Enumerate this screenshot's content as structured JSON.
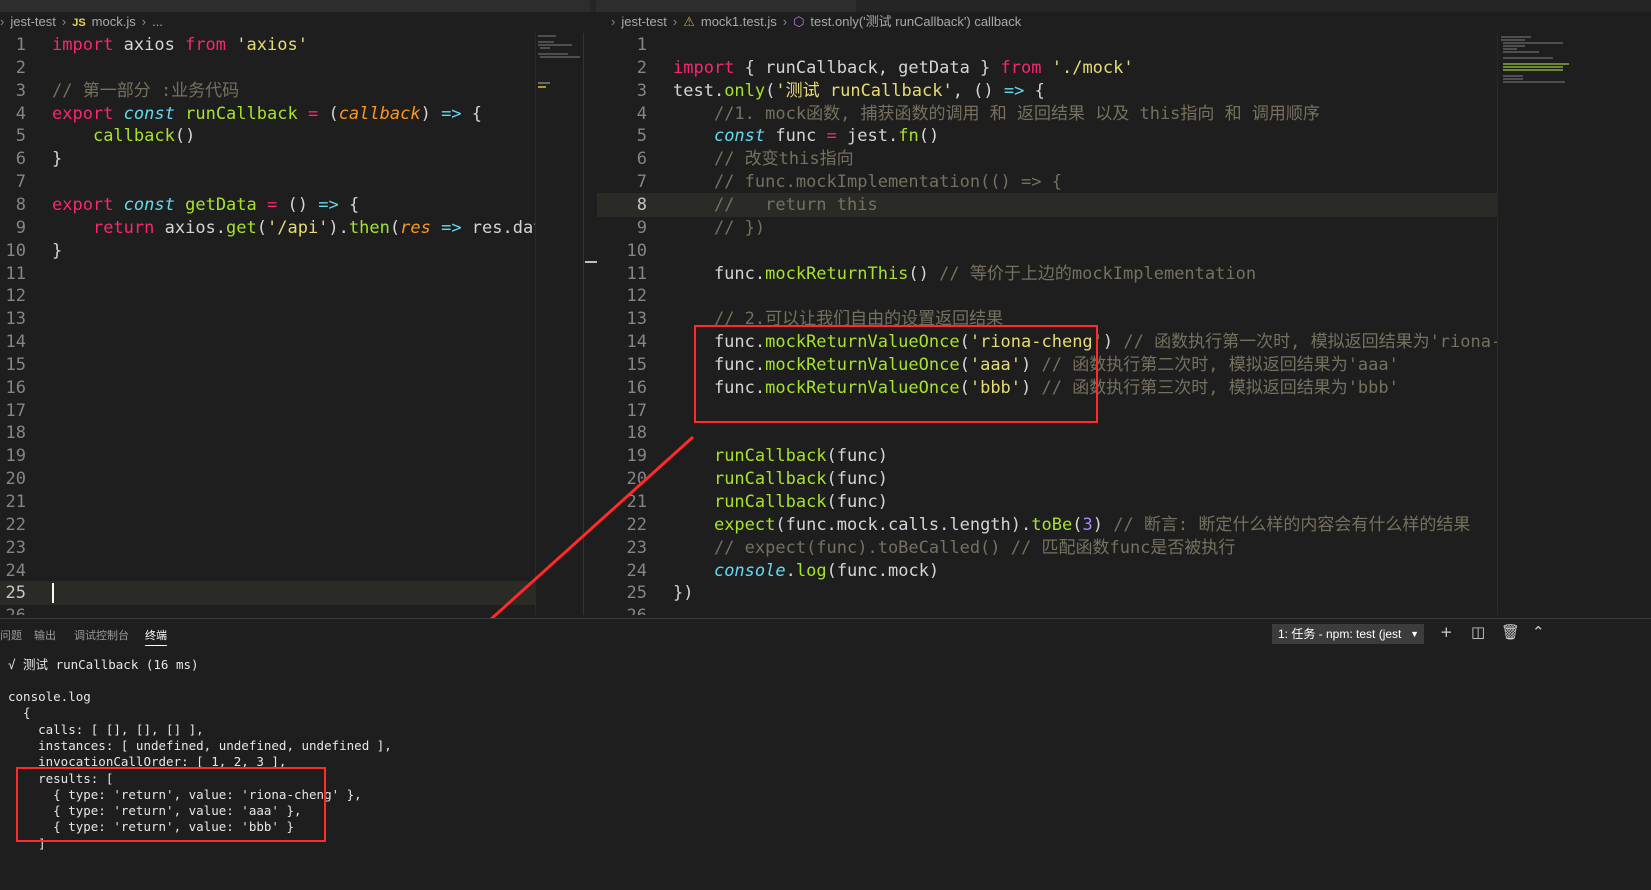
{
  "left_editor": {
    "breadcrumb": {
      "folder": "jest-test",
      "file_icon": "JS",
      "file": "mock.js",
      "more": "..."
    },
    "lines": [
      {
        "n": "1",
        "html": "<span class='kw'>import</span> axios <span class='kw'>from</span> <span class='str'>'axios'</span>"
      },
      {
        "n": "2",
        "html": ""
      },
      {
        "n": "3",
        "html": "<span class='cm'>// 第一部分 :业务代码</span>"
      },
      {
        "n": "4",
        "html": "<span class='kw'>export</span> <span class='kw2'>const</span> <span class='fn'>runCallback</span> <span class='op'>=</span> (<span class='param'>callback</span>) <span class='kw2'>=&gt;</span> {"
      },
      {
        "n": "5",
        "html": "    <span class='fn'>callback</span>()"
      },
      {
        "n": "6",
        "html": "}"
      },
      {
        "n": "7",
        "html": ""
      },
      {
        "n": "8",
        "html": "<span class='kw'>export</span> <span class='kw2'>const</span> <span class='fn'>getData</span> <span class='op'>=</span> () <span class='kw2'>=&gt;</span> {"
      },
      {
        "n": "9",
        "html": "    <span class='kw'>return</span> axios.<span class='fn'>get</span>(<span class='str'>'/api'</span>).<span class='fn'>then</span>(<span class='param'>res</span> <span class='kw2'>=&gt;</span> res.data)"
      },
      {
        "n": "10",
        "html": "}"
      },
      {
        "n": "11",
        "html": ""
      },
      {
        "n": "12",
        "html": ""
      },
      {
        "n": "13",
        "html": ""
      },
      {
        "n": "14",
        "html": ""
      },
      {
        "n": "15",
        "html": ""
      },
      {
        "n": "16",
        "html": ""
      },
      {
        "n": "17",
        "html": ""
      },
      {
        "n": "18",
        "html": ""
      },
      {
        "n": "19",
        "html": ""
      },
      {
        "n": "20",
        "html": ""
      },
      {
        "n": "21",
        "html": ""
      },
      {
        "n": "22",
        "html": ""
      },
      {
        "n": "23",
        "html": ""
      },
      {
        "n": "24",
        "html": ""
      },
      {
        "n": "25",
        "html": "",
        "active": true
      },
      {
        "n": "26",
        "html": ""
      }
    ]
  },
  "right_editor": {
    "breadcrumb": {
      "folder": "jest-test",
      "file": "mock1.test.js",
      "symbol": "test.only('测试 runCallback') callback"
    },
    "lines": [
      {
        "n": "1",
        "html": ""
      },
      {
        "n": "2",
        "html": "<span class='kw'>import</span> { runCallback, getData } <span class='kw'>from</span> <span class='str'>'./mock'</span>"
      },
      {
        "n": "3",
        "html": "test.<span class='fn'>only</span>(<span class='str'>'测试 runCallback'</span>, () <span class='kw2'>=&gt;</span> {"
      },
      {
        "n": "4",
        "html": "    <span class='cm'>//1. mock函数, 捕获函数的调用 和 返回结果 以及 this指向 和 调用顺序</span>"
      },
      {
        "n": "5",
        "html": "    <span class='kw2'>const</span> func <span class='op'>=</span> jest.<span class='fn'>fn</span>()"
      },
      {
        "n": "6",
        "html": "    <span class='cm'>// 改变this指向</span>"
      },
      {
        "n": "7",
        "html": "    <span class='cm'>// func.mockImplementation(() =&gt; {</span>"
      },
      {
        "n": "8",
        "html": "    <span class='cm'>//   return this</span>",
        "active": true
      },
      {
        "n": "9",
        "html": "    <span class='cm'>// })</span>"
      },
      {
        "n": "10",
        "html": ""
      },
      {
        "n": "11",
        "html": "    func.<span class='fn'>mockReturnThis</span>() <span class='cm'>// 等价于上边的mockImplementation</span>"
      },
      {
        "n": "12",
        "html": ""
      },
      {
        "n": "13",
        "html": "    <span class='cm'>// 2.可以让我们自由的设置返回结果</span>"
      },
      {
        "n": "14",
        "html": "    func.<span class='fn'>mockReturnValueOnce</span>(<span class='str'>'riona-cheng'</span>) <span class='cm'>// 函数执行第一次时, 模拟返回结果为'riona-cheng</span>"
      },
      {
        "n": "15",
        "html": "    func.<span class='fn'>mockReturnValueOnce</span>(<span class='str'>'aaa'</span>) <span class='cm'>// 函数执行第二次时, 模拟返回结果为'aaa'</span>"
      },
      {
        "n": "16",
        "html": "    func.<span class='fn'>mockReturnValueOnce</span>(<span class='str'>'bbb'</span>) <span class='cm'>// 函数执行第三次时, 模拟返回结果为'bbb'</span>"
      },
      {
        "n": "17",
        "html": ""
      },
      {
        "n": "18",
        "html": ""
      },
      {
        "n": "19",
        "html": "    <span class='fn'>runCallback</span>(func)"
      },
      {
        "n": "20",
        "html": "    <span class='fn'>runCallback</span>(func)"
      },
      {
        "n": "21",
        "html": "    <span class='fn'>runCallback</span>(func)"
      },
      {
        "n": "22",
        "html": "    <span class='fn'>expect</span>(func.mock.calls.length).<span class='fn'>toBe</span>(<span class='num'>3</span>) <span class='cm'>// 断言: 断定什么样的内容会有什么样的结果</span>"
      },
      {
        "n": "23",
        "html": "    <span class='cm'>// expect(func).toBeCalled() // 匹配函数func是否被执行</span>"
      },
      {
        "n": "24",
        "html": "    <span class='kw2'>console</span>.<span class='fn'>log</span>(func.mock)"
      },
      {
        "n": "25",
        "html": "})"
      },
      {
        "n": "26",
        "html": ""
      }
    ]
  },
  "panel": {
    "tabs": [
      "问题",
      "输出",
      "调试控制台",
      "终端"
    ],
    "active_tab": "终端",
    "task_select": "1: 任务 - npm: test (jest",
    "terminal_lines": [
      "√ 测试 runCallback (16 ms)",
      "",
      "console.log",
      "  {",
      "    calls: [ [], [], [] ],",
      "    instances: [ undefined, undefined, undefined ],",
      "    invocationCallOrder: [ 1, 2, 3 ],",
      "    results: [",
      "      { type: 'return', value: 'riona-cheng' },",
      "      { type: 'return', value: 'aaa' },",
      "      { type: 'return', value: 'bbb' }",
      "    ]"
    ],
    "icons": [
      "plus-icon",
      "split-icon",
      "trash-icon",
      "chevron-up-icon"
    ]
  },
  "colors": {
    "annotation": "#ff2a2a",
    "background": "#1e1e1e"
  }
}
